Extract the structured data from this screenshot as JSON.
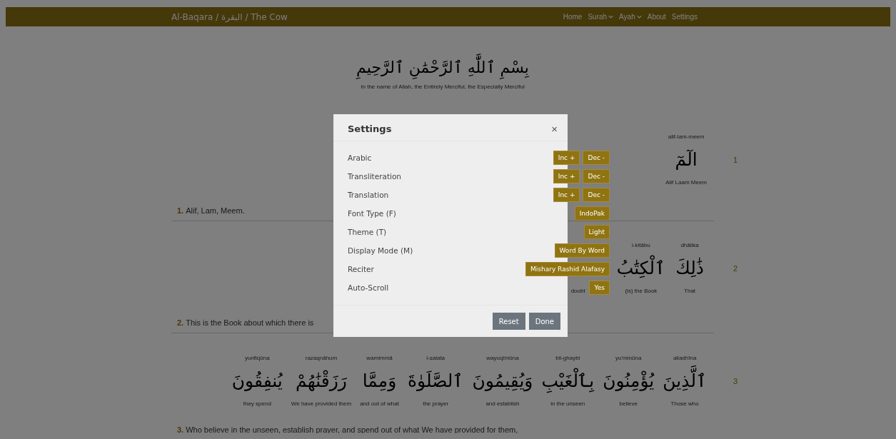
{
  "nav": {
    "title": "Al-Baqara / البقرة / The Cow",
    "links": [
      {
        "label": "Home",
        "dropdown": false
      },
      {
        "label": "Surah",
        "dropdown": true
      },
      {
        "label": "Ayah",
        "dropdown": true
      },
      {
        "label": "About",
        "dropdown": false
      },
      {
        "label": "Settings",
        "dropdown": false
      }
    ]
  },
  "bismillah": {
    "arabic": "بِسْمِ ٱللَّٰهِ ٱلرَّحْمَٰنِ ٱلرَّحِيمِ",
    "translation": "In the name of Allah, the Entirely Merciful, the Especially Merciful"
  },
  "ayahs": [
    {
      "number": "1",
      "translation_number": "1.",
      "translation": "Alif, Lam, Meem.",
      "arabic_words": [
        "الٓمٓ"
      ],
      "glosses": [
        {
          "translit": "alif-lam-meem",
          "meaning": "Alif Laam Meem"
        }
      ]
    },
    {
      "number": "2",
      "translation_number": "2.",
      "translation": "This is the Book about which there is",
      "arabic_words": [
        "ذَٰلِكَ",
        "ٱلْكِتَٰبُ"
      ],
      "glosses": [
        {
          "meaning": "doubt"
        },
        {
          "translit": "l-kitābu",
          "meaning": "(is) the Book"
        },
        {
          "translit": "dhālika",
          "meaning": "That"
        }
      ]
    },
    {
      "number": "3",
      "translation_number": "3.",
      "translation": "Who believe in the unseen, establish prayer, and spend out of what We have provided for them,",
      "arabic_words": [
        "ٱلَّذِينَ",
        "يُؤْمِنُونَ",
        "بِٱلْغَيْبِ",
        "وَيُقِيمُونَ",
        "ٱلصَّلَوٰةَ",
        "وَمِمَّا",
        "رَزَقْنَٰهُمْ",
        "يُنفِقُونَ"
      ],
      "glosses": [
        {
          "translit": "yunfiqūna",
          "meaning": "they spend"
        },
        {
          "translit": "razaqnāhum",
          "meaning": "We have provided them"
        },
        {
          "translit": "wamimmā",
          "meaning": "and out of what"
        },
        {
          "translit": "l-ṣalata",
          "meaning": "the prayer"
        },
        {
          "translit": "wayuqīmūna",
          "meaning": "and establish"
        },
        {
          "translit": "bil-ghaybi",
          "meaning": "in the unseen"
        },
        {
          "translit": "yu'minūna",
          "meaning": "believe"
        },
        {
          "translit": "alladhīna",
          "meaning": "Those who"
        }
      ]
    }
  ],
  "modal": {
    "title": "Settings",
    "close": "×",
    "rows": [
      {
        "label": "Arabic",
        "kind": "stepper",
        "buttons": [
          "Inc +",
          "Dec -"
        ]
      },
      {
        "label": "Transliteration",
        "kind": "stepper",
        "buttons": [
          "Inc +",
          "Dec -"
        ]
      },
      {
        "label": "Translation",
        "kind": "stepper",
        "buttons": [
          "Inc +",
          "Dec -"
        ]
      },
      {
        "label": "Font Type (F)",
        "kind": "option",
        "value": "IndoPak"
      },
      {
        "label": "Theme (T)",
        "kind": "option",
        "value": "Light"
      },
      {
        "label": "Display Mode (M)",
        "kind": "option",
        "value": "Word By Word"
      },
      {
        "label": "Reciter",
        "kind": "option",
        "value": "Mishary Rashid Alafasy"
      },
      {
        "label": "Auto-Scroll",
        "kind": "option",
        "value": "Yes"
      }
    ],
    "actions": [
      "Reset",
      "Done"
    ]
  }
}
